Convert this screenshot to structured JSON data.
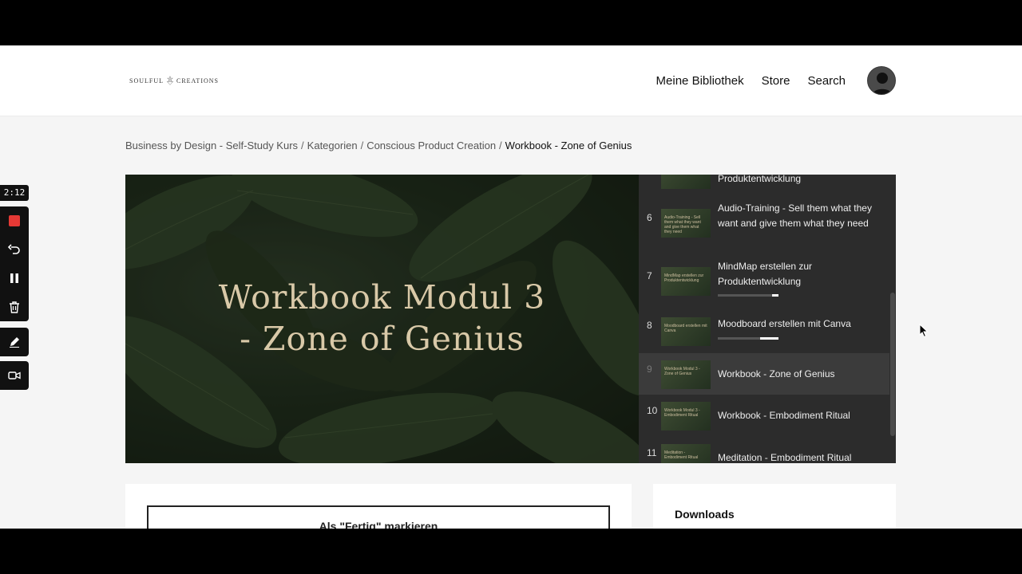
{
  "header": {
    "logo_left": "SOULFUL",
    "logo_right": "CREATIONS",
    "nav": [
      "Meine Bibliothek",
      "Store",
      "Search"
    ]
  },
  "breadcrumb": {
    "items": [
      "Business by Design - Self-Study Kurs",
      "Kategorien",
      "Conscious Product Creation"
    ],
    "separator": "/",
    "current": "Workbook - Zone of Genius"
  },
  "slide": {
    "title_line1": "Workbook Modul 3",
    "title_line2": "- Zone of Genius"
  },
  "playlist": {
    "items": [
      {
        "num": "",
        "label": "Produktentwicklung",
        "thumb": ""
      },
      {
        "num": "6",
        "label": "Audio-Training - Sell them what they want and give them what they need",
        "thumb": "Audio-Training - Sell them what they want and give them what they need"
      },
      {
        "num": "7",
        "label": "MindMap erstellen zur Produktentwicklung",
        "thumb": "MindMap erstellen zur Produktentwicklung",
        "progress": 0.1
      },
      {
        "num": "8",
        "label": "Moodboard erstellen mit Canva",
        "thumb": "Moodboard erstellen mit Canva",
        "progress": 0.3
      },
      {
        "num": "9",
        "label": "Workbook - Zone of Genius",
        "thumb": "Workbook Modul 3 - Zone of Genius",
        "active": true
      },
      {
        "num": "10",
        "label": "Workbook - Embodiment Ritual",
        "thumb": "Workbook Modul 3 - Embodiment Ritual"
      },
      {
        "num": "11",
        "label": "Meditation - Embodiment Ritual",
        "thumb": "Meditation - Embodiment Ritual"
      }
    ]
  },
  "main": {
    "complete_button": "Als \"Fertig\" markieren",
    "downloads_title": "Downloads"
  },
  "recorder": {
    "time": "2:12"
  },
  "colors": {
    "slide_title": "#d9c9a8",
    "playlist_bg": "#2c2c2c",
    "record_red": "#e53935"
  }
}
